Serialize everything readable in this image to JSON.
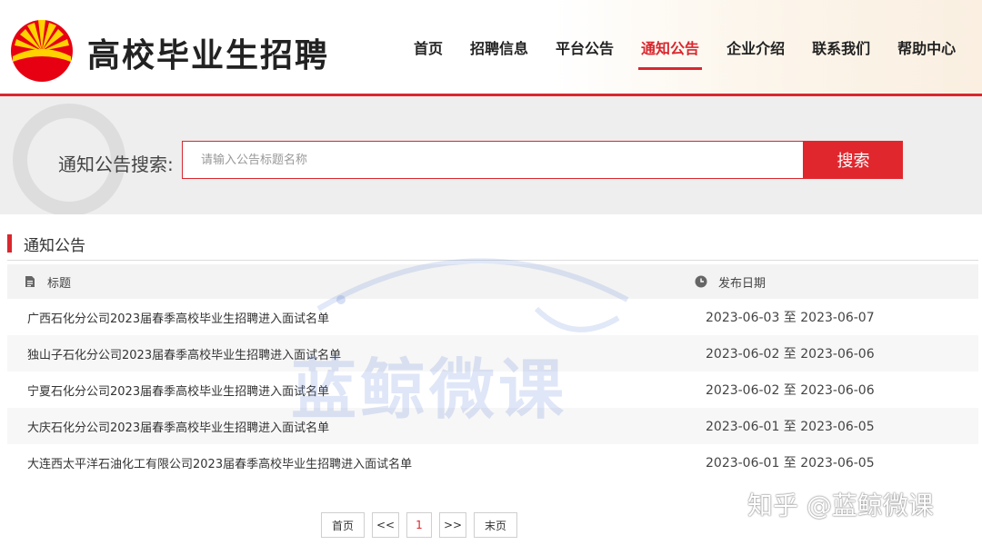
{
  "header": {
    "site_title": "高校毕业生招聘",
    "nav": [
      {
        "label": "首页"
      },
      {
        "label": "招聘信息"
      },
      {
        "label": "平台公告"
      },
      {
        "label": "通知公告",
        "active": true
      },
      {
        "label": "企业介绍"
      },
      {
        "label": "联系我们"
      },
      {
        "label": "帮助中心"
      }
    ]
  },
  "search": {
    "label": "通知公告搜索:",
    "placeholder": "请输入公告标题名称",
    "button": "搜索"
  },
  "section": {
    "title": "通知公告"
  },
  "table": {
    "headers": {
      "title": "标题",
      "date": "发布日期"
    },
    "rows": [
      {
        "title": "广西石化分公司2023届春季高校毕业生招聘进入面试名单",
        "date": "2023-06-03 至 2023-06-07"
      },
      {
        "title": "独山子石化分公司2023届春季高校毕业生招聘进入面试名单",
        "date": "2023-06-02 至 2023-06-06"
      },
      {
        "title": "宁夏石化分公司2023届春季高校毕业生招聘进入面试名单",
        "date": "2023-06-02 至 2023-06-06"
      },
      {
        "title": "大庆石化分公司2023届春季高校毕业生招聘进入面试名单",
        "date": "2023-06-01 至 2023-06-05"
      },
      {
        "title": "大连西太平洋石油化工有限公司2023届春季高校毕业生招聘进入面试名单",
        "date": "2023-06-01 至 2023-06-05"
      }
    ]
  },
  "pager": {
    "first": "首页",
    "prev": "<<",
    "current": "1",
    "next": ">>",
    "last": "末页"
  },
  "watermark": {
    "text": "蓝鲸微课",
    "zhihu": "知乎 @蓝鲸微课"
  },
  "colors": {
    "accent": "#d9272e",
    "button": "#e1272e",
    "search_band": "#eeeeee"
  }
}
